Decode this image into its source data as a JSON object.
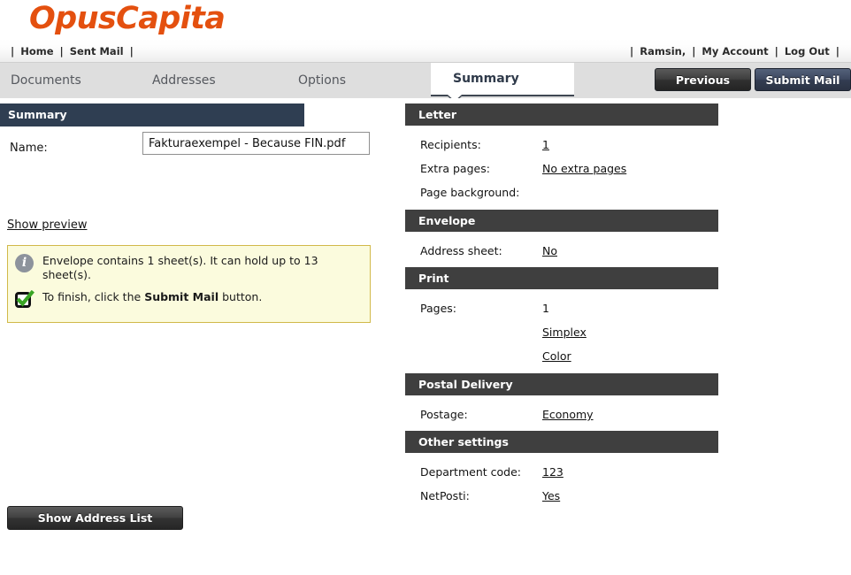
{
  "brand": {
    "logo_text": "OpusCapita",
    "logo_color": "#e4500f"
  },
  "top_nav": {
    "left_items": [
      {
        "label": "Home"
      },
      {
        "label": "Sent Mail"
      }
    ],
    "right_items": [
      {
        "label": "Ramsin,"
      },
      {
        "label": "My Account"
      },
      {
        "label": "Log Out"
      }
    ],
    "separator": "|"
  },
  "tabs": [
    {
      "label": "Documents",
      "active": false
    },
    {
      "label": "Addresses",
      "active": false
    },
    {
      "label": "Options",
      "active": false
    },
    {
      "label": "Summary",
      "active": true
    }
  ],
  "toolbar": {
    "previous_label": "Previous",
    "submit_label": "Submit Mail"
  },
  "left_panel": {
    "title": "Summary",
    "name_label": "Name:",
    "name_value": "Fakturaexempel - Because FIN.pdf",
    "name_placeholder": "",
    "show_preview_label": "Show preview",
    "address_list_button": "Show Address List",
    "info_messages": [
      {
        "icon": "info-icon",
        "text": "Envelope contains 1 sheet(s). It can hold up to 13 sheet(s).",
        "bold": ""
      },
      {
        "icon": "check-icon",
        "text_before": "To finish, click the ",
        "bold": "Submit Mail",
        "text_after": " button."
      }
    ]
  },
  "sections": [
    {
      "title": "Letter",
      "status": "checked",
      "rows": [
        {
          "label": "Recipients:",
          "value": "1",
          "link": true
        },
        {
          "label": "Extra pages:",
          "value": "No extra pages",
          "link": true
        },
        {
          "label": "Page background:",
          "value": "",
          "link": false
        }
      ]
    },
    {
      "title": "Envelope",
      "status": "checked",
      "rows": [
        {
          "label": "Address sheet:",
          "value": "No",
          "link": true
        }
      ]
    },
    {
      "title": "Print",
      "status": "checked",
      "rows": [
        {
          "label": "Pages:",
          "value": "1",
          "link": false
        },
        {
          "label": "",
          "value": "Simplex",
          "link": true
        },
        {
          "label": "",
          "value": "Color",
          "link": true
        }
      ]
    },
    {
      "title": "Postal Delivery",
      "status": "checked",
      "rows": [
        {
          "label": "Postage:",
          "value": "Economy",
          "link": true
        }
      ]
    },
    {
      "title": "Other settings",
      "status": "checked",
      "rows": [
        {
          "label": "Department code:",
          "value": "123",
          "link": true
        },
        {
          "label": "NetPosti:",
          "value": "Yes",
          "link": true
        }
      ]
    }
  ],
  "colors": {
    "brand_orange": "#e4500f",
    "left_header_navy": "#2f3e52",
    "section_header_gray": "#3f3f3f",
    "tabbar_gray": "#dedede",
    "check_green": "#39a524",
    "info_yellow_bg": "#fbfbdd",
    "info_yellow_border": "#d1b949",
    "submit_blue": "#3d4860"
  }
}
